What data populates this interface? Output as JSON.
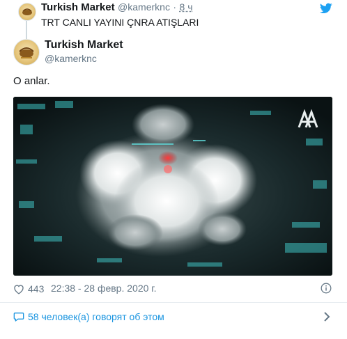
{
  "reply": {
    "name": "Turkish Market",
    "handle": "@kamerknc",
    "dot": "·",
    "time": "8 ч",
    "text": "TRT CANLI YAYINI ÇNRA ATIŞLARI"
  },
  "tweet": {
    "name": "Turkish Market",
    "handle": "@kamerknc",
    "text": "O anlar."
  },
  "media": {
    "watermark": "AA"
  },
  "footer": {
    "likes": "443",
    "timestamp": "22:38 - 28 февр. 2020 г."
  },
  "conversation": {
    "label": "58 человек(а) говорят об этом"
  },
  "colors": {
    "twitter_blue": "#1da1f2",
    "link_blue": "#1b95e0",
    "muted": "#657786"
  },
  "icons": [
    "twitter-bird-icon",
    "heart-icon",
    "info-icon",
    "speech-bubble-icon",
    "chevron-right-icon"
  ]
}
